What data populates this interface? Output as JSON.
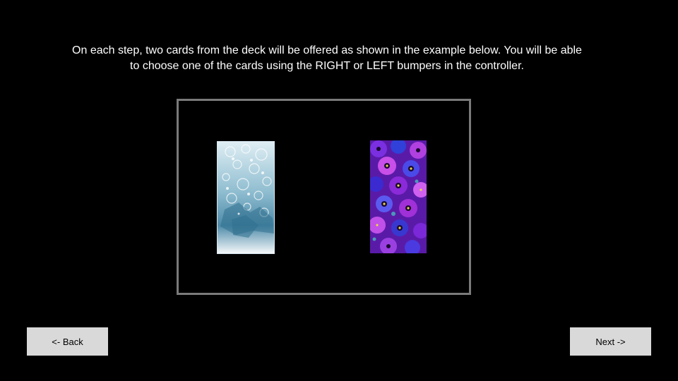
{
  "instructions": {
    "line1": "On each step, two cards from the deck will be offered as shown in the example below. You will be able",
    "line2": "to choose one of  the cards using the RIGHT or LEFT bumpers in the controller."
  },
  "example": {
    "left_card": {
      "pattern": "snowflake-pattern",
      "colors": [
        "#e8f2f6",
        "#6fa3bc",
        "#2a5f7a"
      ]
    },
    "right_card": {
      "pattern": "pansy-flower-pattern",
      "colors": [
        "#7a1fd0",
        "#3b3fe0",
        "#c24fe8",
        "#e8d84a"
      ]
    }
  },
  "navigation": {
    "back_label": "<- Back",
    "next_label": "Next ->"
  },
  "colors": {
    "background": "#000000",
    "frame_border": "#7a7a7a",
    "button_bg": "#d9d9d9"
  }
}
